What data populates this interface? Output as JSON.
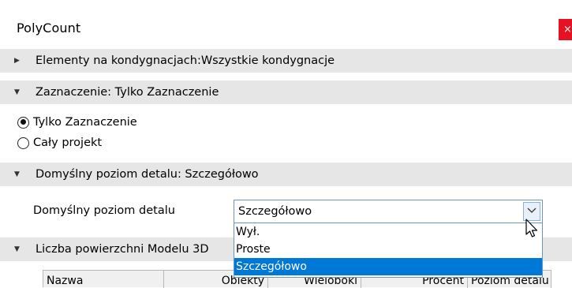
{
  "window": {
    "title": "PolyCount",
    "close_glyph": "×"
  },
  "sections": {
    "elements": {
      "label": "Elementy na kondygnacjach:Wszystkie kondygnacje",
      "expanded": false
    },
    "selection": {
      "label": "Zaznaczenie: Tylko Zaznaczenie",
      "expanded": true
    },
    "detail": {
      "label": "Domyślny poziom detalu: Szczegółowo",
      "expanded": true
    },
    "faces": {
      "label": "Liczba powierzchni Modelu 3D",
      "expanded": true
    }
  },
  "radios": [
    {
      "label": "Tylko Zaznaczenie",
      "checked": true
    },
    {
      "label": "Cały projekt",
      "checked": false
    }
  ],
  "detail_field": {
    "label": "Domyślny poziom detalu",
    "value": "Szczegółowo",
    "options": [
      "Wył.",
      "Proste",
      "Szczegółowo"
    ],
    "selected_index": 2
  },
  "table": {
    "columns": [
      "Nazwa",
      "Obiekty",
      "Wieloboki",
      "Procent",
      "Poziom detalu"
    ]
  },
  "colors": {
    "section_bg": "#e6e6e6",
    "selection_blue": "#0078d7",
    "close_red": "#e81123"
  }
}
